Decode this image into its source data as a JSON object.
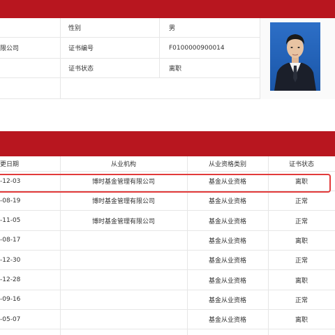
{
  "info": {
    "rows": [
      {
        "left_value": "",
        "label": "性别",
        "value": "男"
      },
      {
        "left_value": "限公司",
        "label": "证书编号",
        "value": "F0100000900014"
      },
      {
        "left_value": "",
        "label": "证书状态",
        "value": "离职"
      },
      {
        "left_value": "",
        "label": "",
        "value": ""
      }
    ]
  },
  "history": {
    "headers": [
      "更日期",
      "从业机构",
      "从业资格类别",
      "证书状态"
    ],
    "rows": [
      {
        "date": "-12-03",
        "org": "博时基金管理有限公司",
        "qual": "基金从业资格",
        "status": "离职"
      },
      {
        "date": "-08-19",
        "org": "博时基金管理有限公司",
        "qual": "基金从业资格",
        "status": "正常"
      },
      {
        "date": "-11-05",
        "org": "博时基金管理有限公司",
        "qual": "基金从业资格",
        "status": "正常"
      },
      {
        "date": "-08-17",
        "org": "",
        "qual": "基金从业资格",
        "status": "离职"
      },
      {
        "date": "-12-30",
        "org": "",
        "qual": "基金从业资格",
        "status": "正常"
      },
      {
        "date": "-12-28",
        "org": "",
        "qual": "基金从业资格",
        "status": "离职"
      },
      {
        "date": "-09-16",
        "org": "",
        "qual": "基金从业资格",
        "status": "正常"
      },
      {
        "date": "-05-07",
        "org": "",
        "qual": "基金从业资格",
        "status": "离职"
      }
    ]
  },
  "colors": {
    "brand_red": "#b8161f",
    "highlight": "#e23a3a"
  }
}
